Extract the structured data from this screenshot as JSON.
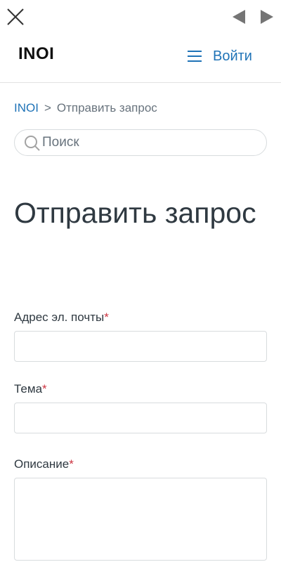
{
  "nav": {
    "close_icon": "close-icon",
    "back_icon": "back-arrow-icon",
    "forward_icon": "forward-arrow-icon",
    "arrow_color": "#757575"
  },
  "header": {
    "logo": "INOI",
    "menu_icon": "hamburger-menu-icon",
    "signin_label": "Войти",
    "accent_color": "#1f73b7"
  },
  "breadcrumb": {
    "items": [
      "INOI",
      "Отправить запрос"
    ],
    "separator": ">"
  },
  "search": {
    "placeholder": "Поиск",
    "icon": "search-icon"
  },
  "page": {
    "title": "Отправить запрос"
  },
  "form": {
    "required_marker": "*",
    "required_color": "#cc3340",
    "fields": [
      {
        "label": "Адрес эл. почты",
        "value": ""
      },
      {
        "label": "Тема",
        "value": ""
      },
      {
        "label": "Описание",
        "value": ""
      }
    ]
  }
}
